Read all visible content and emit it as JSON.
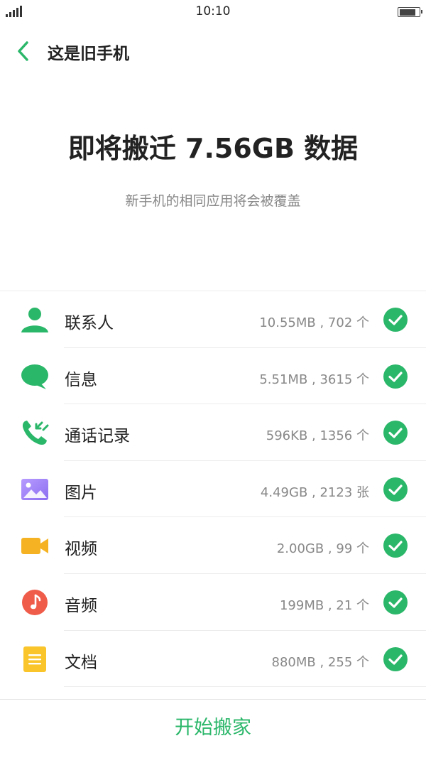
{
  "status_bar": {
    "time": "10:10",
    "battery_level_pct": 85
  },
  "nav": {
    "title": "这是旧手机",
    "back_icon": "chevron-left-icon"
  },
  "header": {
    "headline": "即将搬迁 7.56GB 数据",
    "subtitle": "新手机的相同应用将会被覆盖"
  },
  "items": [
    {
      "label": "联系人",
      "meta": "10.55MB , 702 个",
      "icon": "contacts-icon",
      "color": "#2bb76a",
      "checked": true
    },
    {
      "label": "信息",
      "meta": "5.51MB , 3615 个",
      "icon": "message-icon",
      "color": "#2bb76a",
      "checked": true
    },
    {
      "label": "通话记录",
      "meta": "596KB , 1356 个",
      "icon": "call-log-icon",
      "color": "#2bb76a",
      "checked": true
    },
    {
      "label": "图片",
      "meta": "4.49GB , 2123 张",
      "icon": "picture-icon",
      "color": "#9b7ff0",
      "checked": true
    },
    {
      "label": "视频",
      "meta": "2.00GB , 99 个",
      "icon": "video-icon",
      "color": "#f5b324",
      "checked": true
    },
    {
      "label": "音频",
      "meta": "199MB , 21 个",
      "icon": "music-icon",
      "color": "#f05c4a",
      "checked": true
    },
    {
      "label": "文档",
      "meta": "880MB , 255 个",
      "icon": "document-icon",
      "color": "#f9c52a",
      "checked": true
    }
  ],
  "footer": {
    "start_label": "开始搬家",
    "accent": "#2bb76a"
  }
}
